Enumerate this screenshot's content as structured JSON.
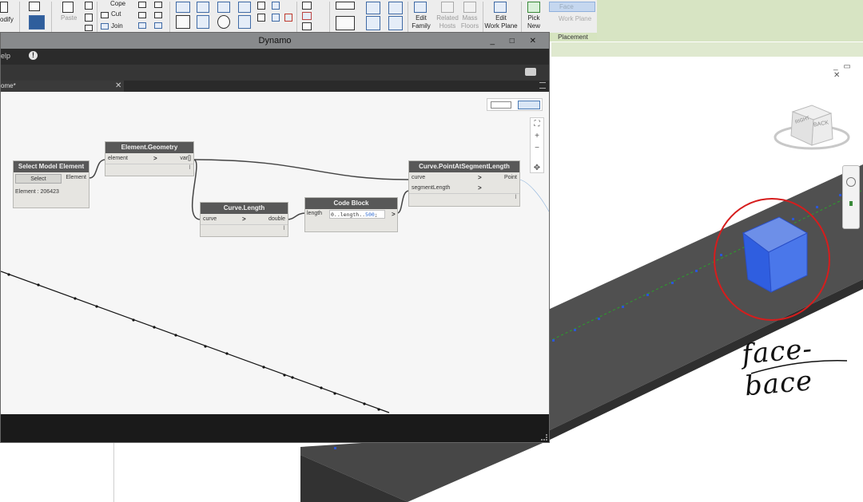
{
  "ribbon": {
    "modify_label": "odify",
    "paste_label": "Paste",
    "cope_label": "Cope",
    "cut_label": "Cut",
    "join_label": "Join",
    "edit_family_line1": "Edit",
    "edit_family_line2": "Family",
    "related_hosts_line1": "Related",
    "related_hosts_line2": "Hosts",
    "mass_floors_line1": "Mass",
    "mass_floors_line2": "Floors",
    "edit_workplane_line1": "Edit",
    "edit_workplane_line2": "Work Plane",
    "pick_new_line1": "Pick",
    "pick_new_line2": "New",
    "face_label": "Face",
    "work_plane_label": "Work Plane",
    "placement_label": "Placement"
  },
  "dynamo": {
    "title": "Dynamo",
    "window_controls": "_ □ ✕",
    "menu_help": "elp",
    "info_glyph": "!",
    "tab_label": "ome*",
    "tab_close": "✕"
  },
  "nodes": {
    "select_model": {
      "title": "Select Model Element",
      "button": "Select",
      "output": "Element",
      "info": "Element : 206423"
    },
    "element_geometry": {
      "title": "Element.Geometry",
      "input": "element",
      "output": "var[]",
      "arrow": ">",
      "pin": "l"
    },
    "curve_length": {
      "title": "Curve.Length",
      "input": "curve",
      "output": "double",
      "arrow": ">",
      "pin": "l"
    },
    "code_block": {
      "title": "Code Block",
      "input": "length",
      "code_prefix": "0..length..",
      "code_number": "500",
      "code_suffix": ";",
      "arrow": ">"
    },
    "point_at_segment": {
      "title": "Curve.PointAtSegmentLength",
      "input1": "curve",
      "input2": "segmentLength",
      "output": "Point",
      "arrow": ">",
      "pin": "l"
    }
  },
  "zoom": {
    "fit": "⛶",
    "zoom_in": "+",
    "zoom_out": "−",
    "pan": "✥"
  },
  "revit_view": {
    "view_controls": "_ ▭ ✕",
    "viewcube_right": "RIGHT",
    "viewcube_back": "BACK",
    "annotation": "face-bace"
  },
  "colors": {
    "accent_blue": "#3d6fd8",
    "annotation_red": "#d61d1d",
    "node_header": "#585858",
    "canvas_bg": "#f6f6f6"
  }
}
